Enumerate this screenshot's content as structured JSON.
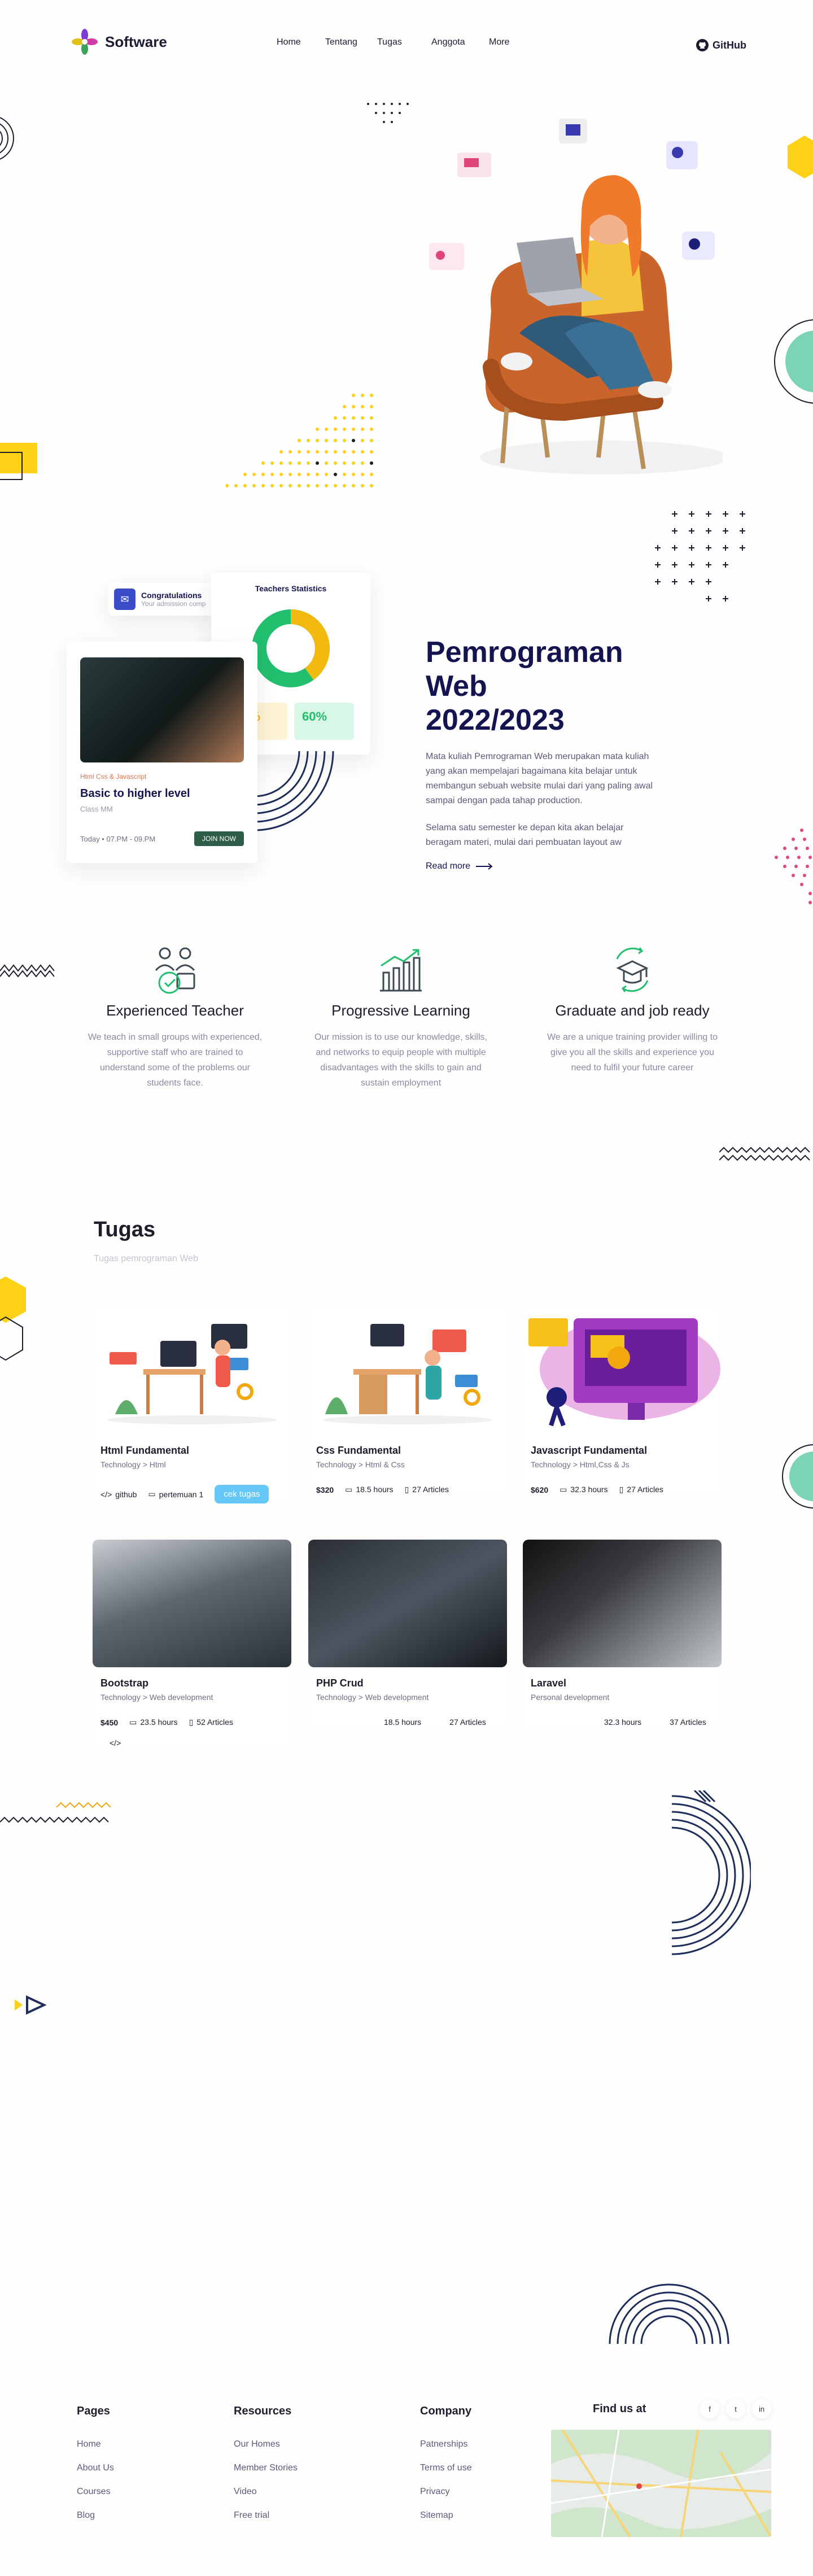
{
  "nav": {
    "brand": "Software",
    "links": [
      "Home",
      "Tentang",
      "Tugas",
      "Anggota",
      "More"
    ],
    "github": "GitHub"
  },
  "promo": {
    "toast_title": "Congratulations",
    "toast_sub": "Your admission comp",
    "stats_title": "Teachers Statistics",
    "stat_a": "40%",
    "stat_b": "60%",
    "card_tag": "Html Css & Javascript",
    "card_title": "Basic to higher level",
    "card_class": "Class MM",
    "card_time": "Today  •  07.PM - 09.PM",
    "card_btn": "JOIN NOW"
  },
  "intro": {
    "title_line1": "Pemrograman Web",
    "title_line2": "2022/2023",
    "para1": "Mata kuliah Pemrograman Web merupakan mata kuliah yang akan mempelajari bagaimana kita belajar untuk membangun sebuah website mulai dari yang paling awal sampai dengan pada tahap production.",
    "para2": "Selama satu semester ke depan kita akan belajar beragam materi, mulai dari pembuatan layout aw",
    "read_more": "Read more"
  },
  "features": [
    {
      "title": "Experienced Teacher",
      "text": "We teach in small groups with experienced, supportive staff who are trained to understand some of the problems our students face.",
      "icon": "teacher-icon"
    },
    {
      "title": "Progressive Learning",
      "text": "Our mission is to use our knowledge, skills, and networks to equip people with multiple disadvantages with the skills to gain and sustain employment",
      "icon": "chart-icon"
    },
    {
      "title": "Graduate and  job ready",
      "text": "We are a unique training provider willing to give you all the skills and experience you need to fulfil your future career",
      "icon": "graduate-icon"
    }
  ],
  "tugas": {
    "title": "Tugas",
    "subtitle": "Tugas pemrograman Web",
    "courses": [
      {
        "name": "Html Fundamental",
        "meta": "Technology > Html",
        "a": "github",
        "b": "pertemuan 1",
        "c": "cek tugas"
      },
      {
        "name": "Css Fundamental",
        "meta": "Technology > Html & Css",
        "a": "$320",
        "b": "18.5 hours",
        "c": "27 Articles"
      },
      {
        "name": "Javascript Fundamental",
        "meta": "Technology > Html,Css & Js",
        "a": "$620",
        "b": "32.3 hours",
        "c": "27 Articles"
      },
      {
        "name": "Bootstrap",
        "meta": "Technology > Web development",
        "a": "$450",
        "b": "23.5 hours",
        "c": "52 Articles"
      },
      {
        "name": "PHP Crud",
        "meta": "Technology > Web development",
        "a": "",
        "b": "18.5 hours",
        "c": "27 Articles"
      },
      {
        "name": "Laravel",
        "meta": "Personal development",
        "a": "",
        "b": "32.3 hours",
        "c": "37 Articles"
      }
    ]
  },
  "footer": {
    "pages_title": "Pages",
    "pages": [
      "Home",
      "About Us",
      "Courses",
      "Blog"
    ],
    "resources_title": "Resources",
    "resources": [
      "Our Homes",
      "Member Stories",
      "Video",
      "Free trial"
    ],
    "company_title": "Company",
    "company": [
      "Patnerships",
      "Terms of use",
      "Privacy",
      "Sitemap"
    ],
    "find_title": "Find us at",
    "social": [
      "f",
      "t",
      "in"
    ]
  },
  "colors": {
    "navy": "#141450",
    "green": "#22bf6e",
    "yellow": "#fcd116",
    "teal": "#7bd3b8",
    "pink": "#e0457b",
    "blue": "#65c7f6"
  }
}
